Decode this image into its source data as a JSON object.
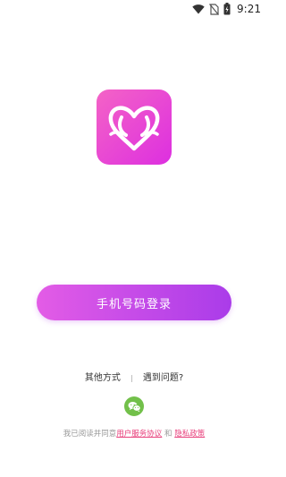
{
  "status_bar": {
    "time": "9:21",
    "icons": [
      "wifi-icon",
      "no-sim-icon",
      "battery-charging-icon"
    ]
  },
  "logo": {
    "icon": "heart-logo-icon",
    "colors": [
      "#f463c6",
      "#dd2fe0"
    ]
  },
  "login": {
    "phone_button_label": "手机号码登录"
  },
  "alternatives": {
    "other_methods_label": "其他方式",
    "help_label": "遇到问题?",
    "wechat_icon": "wechat-icon",
    "wechat_color": "#72c04a"
  },
  "agreement": {
    "prefix": "我已阅读并同意",
    "user_agreement": "用户服务协议",
    "conjunction": " 和 ",
    "privacy_policy": "隐私政策",
    "link_color": "#e8407c"
  },
  "theme": {
    "button_gradient": [
      "#e35ce6",
      "#aa3ce9"
    ]
  }
}
